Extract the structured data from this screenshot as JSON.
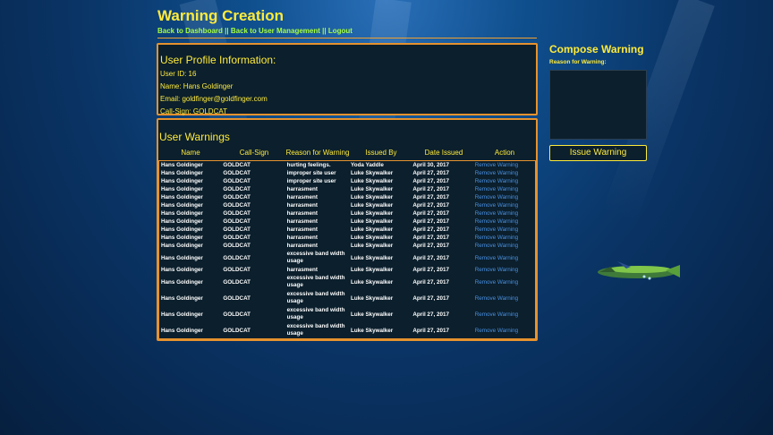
{
  "page": {
    "title": "Warning Creation"
  },
  "nav": {
    "dashboard": "Back to Dashboard",
    "user_mgmt": "Back to User Management",
    "logout": "Logout",
    "sep": "||"
  },
  "profile": {
    "heading": "User Profile Information:",
    "user_id": "User ID: 16",
    "name": "Name: Hans Goldinger",
    "email": "Email: goldfinger@goldfinger.com",
    "callsign": "Call-Sign: GOLDCAT"
  },
  "warnings": {
    "heading": "User Warnings",
    "columns": [
      "Name",
      "Call-Sign",
      "Reason for Warning",
      "Issued By",
      "Date Issued",
      "Action"
    ],
    "rows": [
      [
        "Hans Goldinger",
        "GOLDCAT",
        "hurting feelings.",
        "Yoda Yaddle",
        "April 30, 2017",
        "Remove Warning"
      ],
      [
        "Hans Goldinger",
        "GOLDCAT",
        "improper site user",
        "Luke Skywalker",
        "April 27, 2017",
        "Remove Warning"
      ],
      [
        "Hans Goldinger",
        "GOLDCAT",
        "improper site user",
        "Luke Skywalker",
        "April 27, 2017",
        "Remove Warning"
      ],
      [
        "Hans Goldinger",
        "GOLDCAT",
        "harrasment",
        "Luke Skywalker",
        "April 27, 2017",
        "Remove Warning"
      ],
      [
        "Hans Goldinger",
        "GOLDCAT",
        "harrasment",
        "Luke Skywalker",
        "April 27, 2017",
        "Remove Warning"
      ],
      [
        "Hans Goldinger",
        "GOLDCAT",
        "harrasment",
        "Luke Skywalker",
        "April 27, 2017",
        "Remove Warning"
      ],
      [
        "Hans Goldinger",
        "GOLDCAT",
        "harrasment",
        "Luke Skywalker",
        "April 27, 2017",
        "Remove Warning"
      ],
      [
        "Hans Goldinger",
        "GOLDCAT",
        "harrasment",
        "Luke Skywalker",
        "April 27, 2017",
        "Remove Warning"
      ],
      [
        "Hans Goldinger",
        "GOLDCAT",
        "harrasment",
        "Luke Skywalker",
        "April 27, 2017",
        "Remove Warning"
      ],
      [
        "Hans Goldinger",
        "GOLDCAT",
        "harrasment",
        "Luke Skywalker",
        "April 27, 2017",
        "Remove Warning"
      ],
      [
        "Hans Goldinger",
        "GOLDCAT",
        "harrasment",
        "Luke Skywalker",
        "April 27, 2017",
        "Remove Warning"
      ],
      [
        "Hans Goldinger",
        "GOLDCAT",
        "excessive band width usage",
        "Luke Skywalker",
        "April 27, 2017",
        "Remove Warning"
      ],
      [
        "Hans Goldinger",
        "GOLDCAT",
        "harrasment",
        "Luke Skywalker",
        "April 27, 2017",
        "Remove Warning"
      ],
      [
        "Hans Goldinger",
        "GOLDCAT",
        "excessive band width usage",
        "Luke Skywalker",
        "April 27, 2017",
        "Remove Warning"
      ],
      [
        "Hans Goldinger",
        "GOLDCAT",
        "excessive band width usage",
        "Luke Skywalker",
        "April 27, 2017",
        "Remove Warning"
      ],
      [
        "Hans Goldinger",
        "GOLDCAT",
        "excessive band width usage",
        "Luke Skywalker",
        "April 27, 2017",
        "Remove Warning"
      ],
      [
        "Hans Goldinger",
        "GOLDCAT",
        "excessive band width usage",
        "Luke Skywalker",
        "April 27, 2017",
        "Remove Warning"
      ]
    ]
  },
  "compose": {
    "heading": "Compose Warning",
    "reason_label": "Reason for Warning:",
    "reason_value": "",
    "button": "Issue Warning"
  },
  "colors": {
    "accent": "#ffeb3b",
    "border": "#e6922e",
    "link": "#a8ff3e",
    "remove": "#4a90e2"
  }
}
